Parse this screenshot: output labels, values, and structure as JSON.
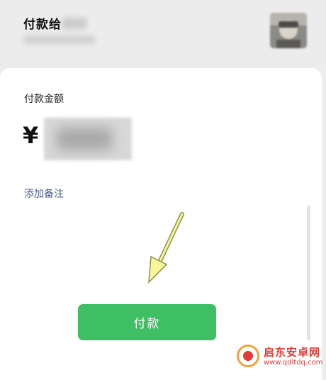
{
  "header": {
    "pay_to_label": "付款给"
  },
  "card": {
    "amount_label": "付款金额",
    "currency_symbol": "¥",
    "add_remark_label": "添加备注",
    "pay_button_label": "付款"
  },
  "watermark": {
    "title": "启东安卓网",
    "url": "www.qdltdq.com"
  },
  "colors": {
    "accent_green": "#3fbf63",
    "link_blue": "#4b5f8a",
    "arrow_yellow": "#f6f69a"
  }
}
